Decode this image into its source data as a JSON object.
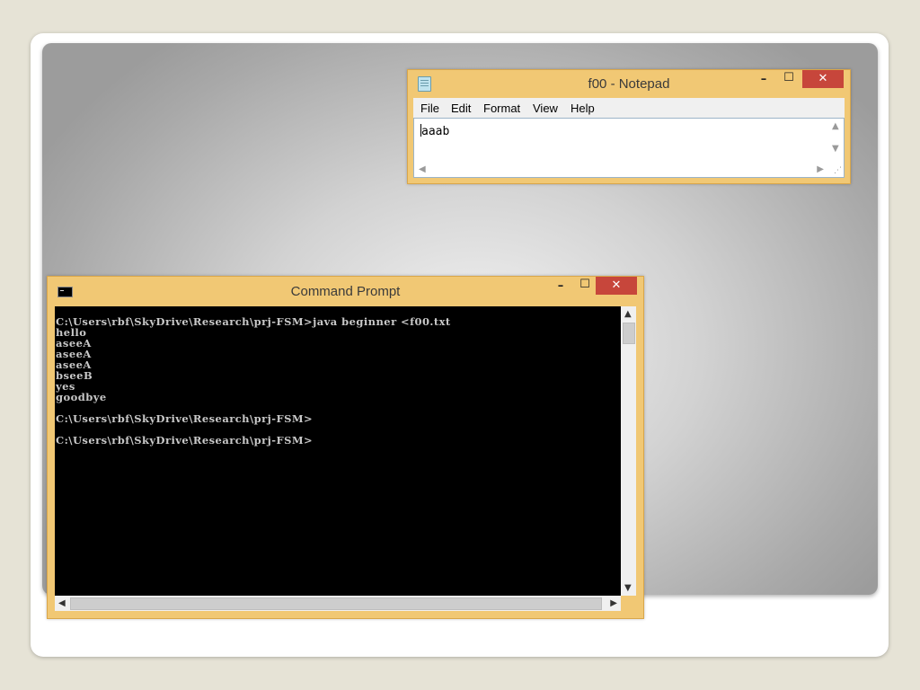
{
  "notepad": {
    "title": "f00 - Notepad",
    "menu": [
      "File",
      "Edit",
      "Format",
      "View",
      "Help"
    ],
    "content": "aaab",
    "controls": {
      "minimize": "–",
      "maximize": "☐",
      "close": "✕"
    }
  },
  "cmd": {
    "title": "Command Prompt",
    "lines": [
      "C:\\Users\\rbf\\SkyDrive\\Research\\prj-FSM>java beginner <f00.txt",
      "hello",
      "aseeA",
      "aseeA",
      "aseeA",
      "bseeB",
      "yes",
      "goodbye",
      "",
      "C:\\Users\\rbf\\SkyDrive\\Research\\prj-FSM>",
      "",
      "C:\\Users\\rbf\\SkyDrive\\Research\\prj-FSM>"
    ],
    "controls": {
      "minimize": "–",
      "maximize": "☐",
      "close": "✕"
    }
  },
  "icons": {
    "notepad": "notepad-app-icon",
    "cmd": "command-prompt-app-icon",
    "scroll_up": "▲",
    "scroll_down": "▼",
    "scroll_left": "◀",
    "scroll_right": "▶"
  },
  "colors": {
    "window_frame": "#f1c874",
    "close_button": "#c7463b",
    "console_bg": "#000000",
    "console_text": "#c8c8c8"
  }
}
